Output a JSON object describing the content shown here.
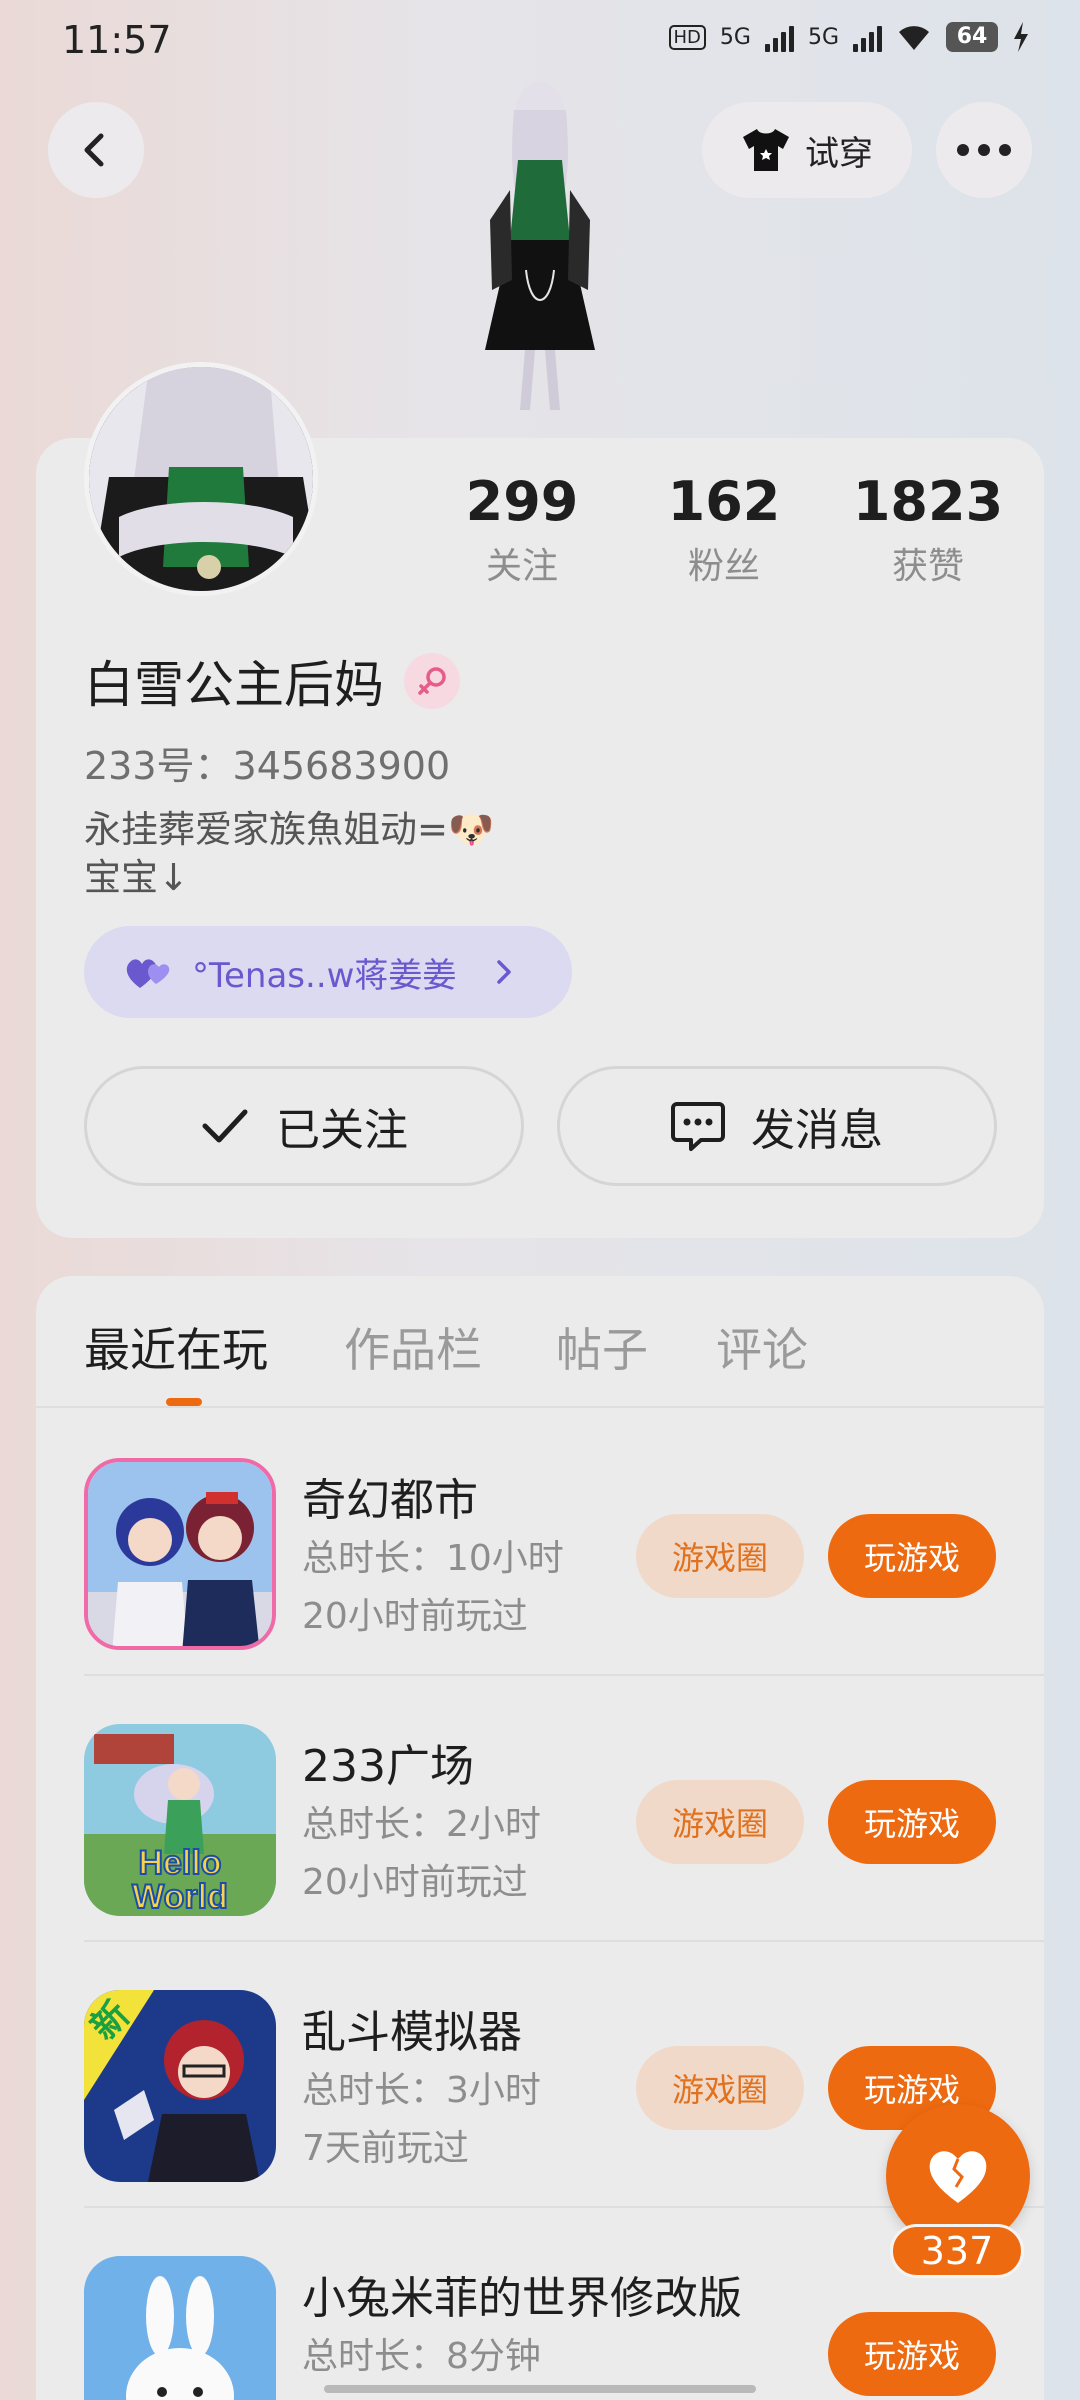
{
  "status_bar": {
    "time": "11:57",
    "network_hd": "HD",
    "network_1": "5G",
    "network_2": "5G",
    "battery": "64"
  },
  "header": {
    "tryon_label": "试穿"
  },
  "profile": {
    "stats": [
      {
        "value": "299",
        "label": "关注"
      },
      {
        "value": "162",
        "label": "粉丝"
      },
      {
        "value": "1823",
        "label": "获赞"
      }
    ],
    "name": "白雪公主后妈",
    "uid": "233号：345683900",
    "bio_line1": "永挂葬爱家族魚姐动=🐶",
    "bio_line2": "宝宝↓",
    "friend_chip": "°Tenas..w蒋姜姜",
    "follow_label": "已关注",
    "message_label": "发消息"
  },
  "tabs": [
    {
      "label": "最近在玩",
      "active": true
    },
    {
      "label": "作品栏",
      "active": false
    },
    {
      "label": "帖子",
      "active": false
    },
    {
      "label": "评论",
      "active": false
    }
  ],
  "games": [
    {
      "title": "奇幻都市",
      "duration": "总时长：10小时",
      "last_played": "20小时前玩过",
      "circle_label": "游戏圈",
      "play_label": "玩游戏"
    },
    {
      "title": "233广场",
      "duration": "总时长：2小时",
      "last_played": "20小时前玩过",
      "circle_label": "游戏圈",
      "play_label": "玩游戏",
      "icon_text_1": "Hello",
      "icon_text_2": "World"
    },
    {
      "title": "乱斗模拟器",
      "duration": "总时长：3小时",
      "last_played": "7天前玩过",
      "circle_label": "游戏圈",
      "play_label": "玩游戏",
      "icon_badge": "新"
    },
    {
      "title": "小兔米菲的世界修改版",
      "duration": "总时长：8分钟",
      "last_played": "",
      "play_label": "玩游戏"
    }
  ],
  "like_fab": {
    "count": "337"
  },
  "colors": {
    "accent": "#ee6a10",
    "chip_purple": "#6a58cf",
    "circle_pill_bg": "#f1d9c9"
  }
}
